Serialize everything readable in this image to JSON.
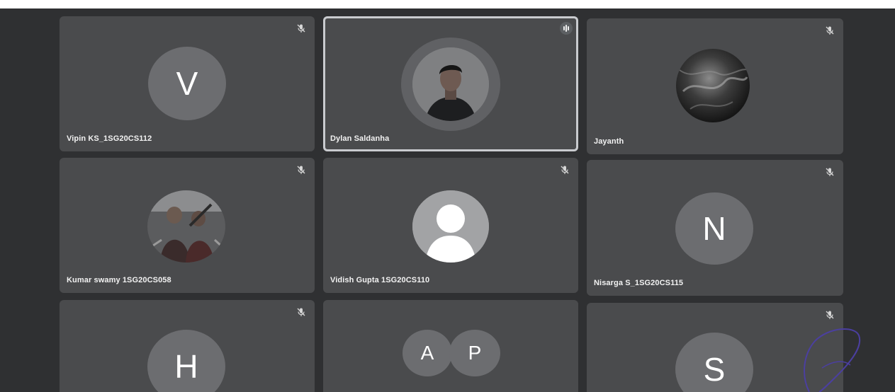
{
  "participants": [
    {
      "name": "Vipin KS_1SG20CS112",
      "avatar_letter": "V",
      "muted": true
    },
    {
      "name": "Dylan Saldanha",
      "muted": false,
      "speaking": true
    },
    {
      "name": "Jayanth",
      "muted": true
    },
    {
      "name": "Kumar swamy 1SG20CS058",
      "muted": true
    },
    {
      "name": "Vidish Gupta 1SG20CS110",
      "muted": true
    },
    {
      "name": "Nisarga S_1SG20CS115",
      "avatar_letter": "N",
      "muted": true
    },
    {
      "name": "",
      "avatar_letter": "H",
      "muted": true
    },
    {
      "name": "",
      "avatar_letters": [
        "A",
        "P"
      ],
      "muted": false
    },
    {
      "name": "",
      "avatar_letter": "S",
      "muted": true
    }
  ],
  "icons": {
    "mic_muted": "mic-off-icon",
    "speaking": "audio-level-icon",
    "default_avatar": "person-icon"
  },
  "colors": {
    "background": "#2f3032",
    "tile": "#4a4b4d",
    "avatar": "#6c6d70",
    "active_border": "#c9cbcf",
    "annotation_ink": "#4b3fa0"
  }
}
